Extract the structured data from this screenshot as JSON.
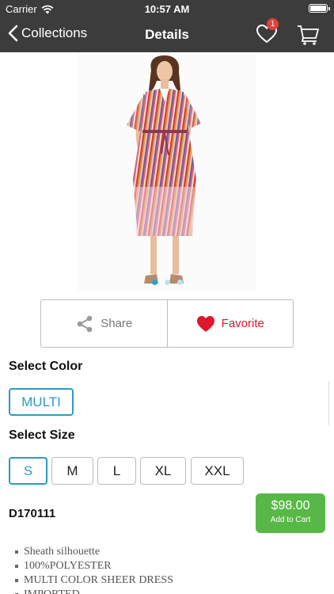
{
  "status_bar": {
    "carrier": "Carrier",
    "time": "10:57 AM"
  },
  "nav": {
    "back_label": "Collections",
    "title": "Details",
    "favorites_badge": "1"
  },
  "carousel": {
    "page_count": 3,
    "active_index": 0
  },
  "actions": {
    "share_label": "Share",
    "favorite_label": "Favorite"
  },
  "color_section": {
    "label": "Select Color",
    "options": [
      "MULTI"
    ],
    "selected": "MULTI"
  },
  "size_section": {
    "label": "Select Size",
    "options": [
      "S",
      "M",
      "L",
      "XL",
      "XXL"
    ],
    "selected": "S"
  },
  "product": {
    "sku": "D170111",
    "price": "$98.00",
    "add_to_cart_label": "Add to Cart",
    "features": [
      "Sheath silhouette",
      "100%POLYESTER",
      "MULTI COLOR SHEER DRESS",
      "IMPORTED"
    ]
  },
  "colors": {
    "header_bg": "#3c3c3c",
    "accent_blue": "#2a9cc2",
    "favorite_red": "#e0162b",
    "cart_green": "#58b847",
    "badge_red": "#e0413a"
  },
  "icons": {
    "wifi": "wifi-icon",
    "battery": "battery-icon",
    "back": "chevron-left-icon",
    "favorites": "heart-outline-icon",
    "cart": "cart-icon",
    "share": "share-icon",
    "favorite": "heart-filled-icon"
  }
}
